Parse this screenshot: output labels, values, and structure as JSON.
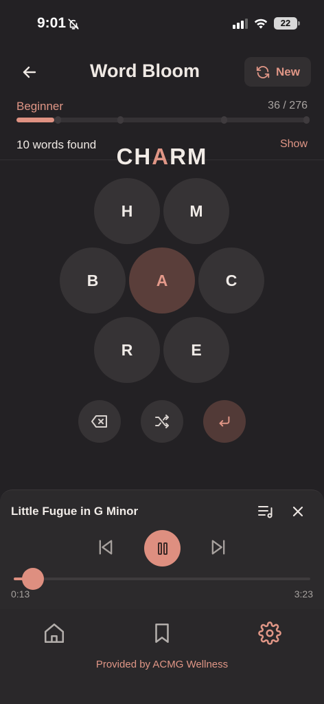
{
  "status_bar": {
    "time": "9:01",
    "battery": "22"
  },
  "header": {
    "title": "Word Bloom",
    "new_label": "New"
  },
  "progress": {
    "level": "Beginner",
    "score": "36 / 276",
    "fraction": 0.13
  },
  "found": {
    "label": "10 words found",
    "show_label": "Show"
  },
  "current_word": {
    "prefix": "CH",
    "highlight": "A",
    "suffix": "RM"
  },
  "letters": {
    "top_left": "H",
    "top_right": "M",
    "mid_left": "B",
    "center": "A",
    "mid_right": "C",
    "bottom_left": "R",
    "bottom_right": "E"
  },
  "controls": [
    "delete-icon",
    "shuffle-icon",
    "enter-icon"
  ],
  "player": {
    "title": "Little Fugue in G Minor",
    "elapsed": "0:13",
    "total": "3:23",
    "progress": 0.064
  },
  "footer": {
    "provided_by": "Provided by ACMG Wellness"
  },
  "colors": {
    "accent": "#e09686",
    "background": "#232124",
    "cell": "#363335",
    "center_cell": "#5a3e3a"
  }
}
